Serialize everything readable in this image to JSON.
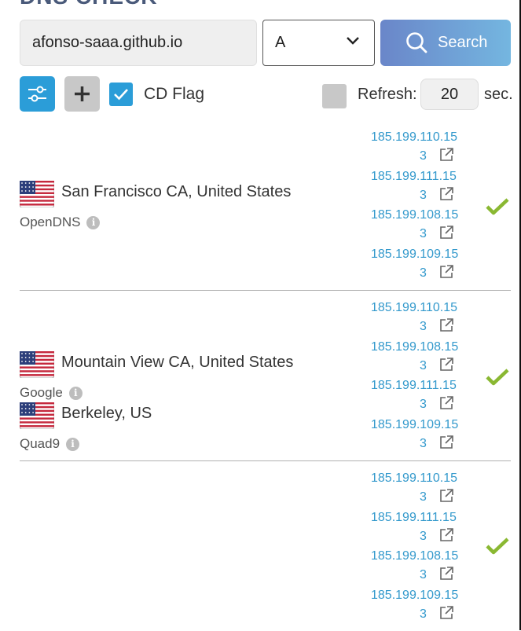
{
  "header": {
    "title": "DNS CHECK"
  },
  "search": {
    "domain_value": "afonso-saaa.github.io",
    "record_type": "A",
    "search_label": "Search"
  },
  "options": {
    "cd_flag_label": "CD Flag",
    "cd_flag_checked": true,
    "refresh_label": "Refresh:",
    "refresh_value": "20",
    "refresh_unit": "sec.",
    "refresh_checked": false
  },
  "colors": {
    "accent_blue": "#2b9dd8",
    "link_blue": "#3399cc",
    "check_green": "#8ab832",
    "search_gradient_start": "#6a86c9",
    "search_gradient_end": "#74b6e0"
  },
  "results": [
    {
      "location": "San Francisco CA, United States",
      "provider": "OpenDNS",
      "flag": "us-flag",
      "status": "ok",
      "ips": [
        {
          "line1": "185.199.110.15",
          "line2": "3"
        },
        {
          "line1": "185.199.111.15",
          "line2": "3"
        },
        {
          "line1": "185.199.108.15",
          "line2": "3"
        },
        {
          "line1": "185.199.109.15",
          "line2": "3"
        }
      ]
    },
    {
      "location": "Mountain View CA, United States",
      "provider": "Google",
      "flag": "us-flag",
      "status": "ok",
      "ips": [
        {
          "line1": "185.199.110.15",
          "line2": "3"
        },
        {
          "line1": "185.199.108.15",
          "line2": "3"
        },
        {
          "line1": "185.199.111.15",
          "line2": "3"
        },
        {
          "line1": "185.199.109.15",
          "line2": "3"
        }
      ]
    },
    {
      "location": "Berkeley, US",
      "provider": "Quad9",
      "flag": "us-flag",
      "status": "ok",
      "ips": [
        {
          "line1": "185.199.110.15",
          "line2": "3"
        },
        {
          "line1": "185.199.111.15",
          "line2": "3"
        },
        {
          "line1": "185.199.108.15",
          "line2": "3"
        },
        {
          "line1": "185.199.109.15",
          "line2": "3"
        }
      ]
    }
  ]
}
